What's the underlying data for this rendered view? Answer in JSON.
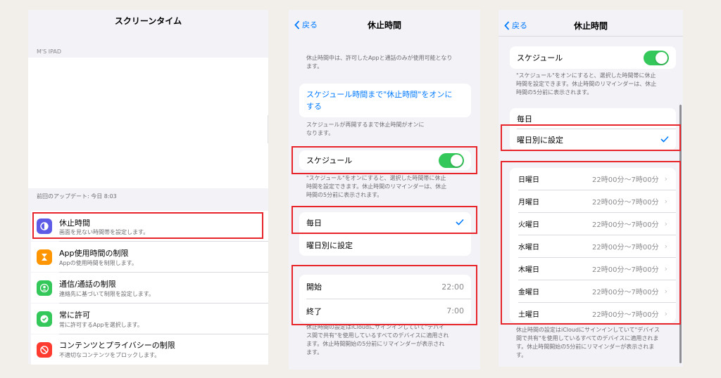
{
  "panel1": {
    "title": "スクリーンタイム",
    "device": "M'S IPAD",
    "last_update": "前回のアップデート: 今日 8:03",
    "items": [
      {
        "title": "休止時間",
        "subtitle": "画面を見ない時間帯を設定します。",
        "icon": "downtime-icon",
        "color": "#5e5ce6"
      },
      {
        "title": "App使用時間の制限",
        "subtitle": "Appの使用時間を制限します。",
        "icon": "hourglass-icon",
        "color": "#ff9500"
      },
      {
        "title": "通信/通話の制限",
        "subtitle": "連絡先に基づいて制限を設定します。",
        "icon": "contact-icon",
        "color": "#34c759"
      },
      {
        "title": "常に許可",
        "subtitle": "常に許可するAppを選択します。",
        "icon": "checkmark-badge-icon",
        "color": "#34c759"
      },
      {
        "title": "コンテンツとプライバシーの制限",
        "subtitle": "不適切なコンテンツをブロックします。",
        "icon": "no-entry-icon",
        "color": "#ff3b30"
      }
    ]
  },
  "panel2": {
    "back": "戻る",
    "title": "休止時間",
    "intro": [
      "休止時間中は、許可したAppと通話のみが使用可能となり",
      "ます。"
    ],
    "link": [
      "スケジュール時間まで\"休止時間\"をオンに",
      "する"
    ],
    "link_note": [
      "スケジュールが再開するまで休止時間がオンに",
      "なります。"
    ],
    "schedule_label": "スケジュール",
    "schedule_on": true,
    "schedule_note": [
      "\"スケジュール\"をオンにすると、選択した時間帯に休止",
      "時間を設定できます。休止時間のリマインダーは、休止",
      "時間の5分前に表示されます。"
    ],
    "everyday": "毎日",
    "per_day": "曜日別に設定",
    "start_label": "開始",
    "start_value": "22:00",
    "end_label": "終了",
    "end_value": "7:00",
    "footer": [
      "休止時間の設定はiCloudにサインインしていて\"デバイ",
      "ス間で共有\"を使用しているすべてのデバイスに適用され",
      "ます。休止時間開始の5分前にリマインダーが表示され",
      "ます。"
    ]
  },
  "panel3": {
    "back": "戻る",
    "title": "休止時間",
    "schedule_label": "スケジュール",
    "schedule_on": true,
    "schedule_note": [
      "\"スケジュール\"をオンにすると、選択した時間帯に休止",
      "時間を設定できます。休止時間のリマインダーは、休止",
      "時間の5分前に表示されます。"
    ],
    "everyday": "毎日",
    "per_day": "曜日別に設定",
    "days": [
      {
        "day": "日曜日",
        "time": "22時00分〜7時00分"
      },
      {
        "day": "月曜日",
        "time": "22時00分〜7時00分"
      },
      {
        "day": "火曜日",
        "time": "22時00分〜7時00分"
      },
      {
        "day": "水曜日",
        "time": "22時00分〜7時00分"
      },
      {
        "day": "木曜日",
        "time": "22時00分〜7時00分"
      },
      {
        "day": "金曜日",
        "time": "22時00分〜7時00分"
      },
      {
        "day": "土曜日",
        "time": "22時00分〜7時00分"
      }
    ],
    "footer": [
      "休止時間の設定はiCloudにサインインしていて\"デバイス",
      "間で共有\"を使用しているすべてのデバイスに適用されま",
      "す。休止時間開始の5分前にリマインダーが表示されま",
      "す。"
    ]
  },
  "colors": {
    "accent": "#007aff",
    "toggle_on": "#34c759",
    "highlight": "#e8242b"
  }
}
